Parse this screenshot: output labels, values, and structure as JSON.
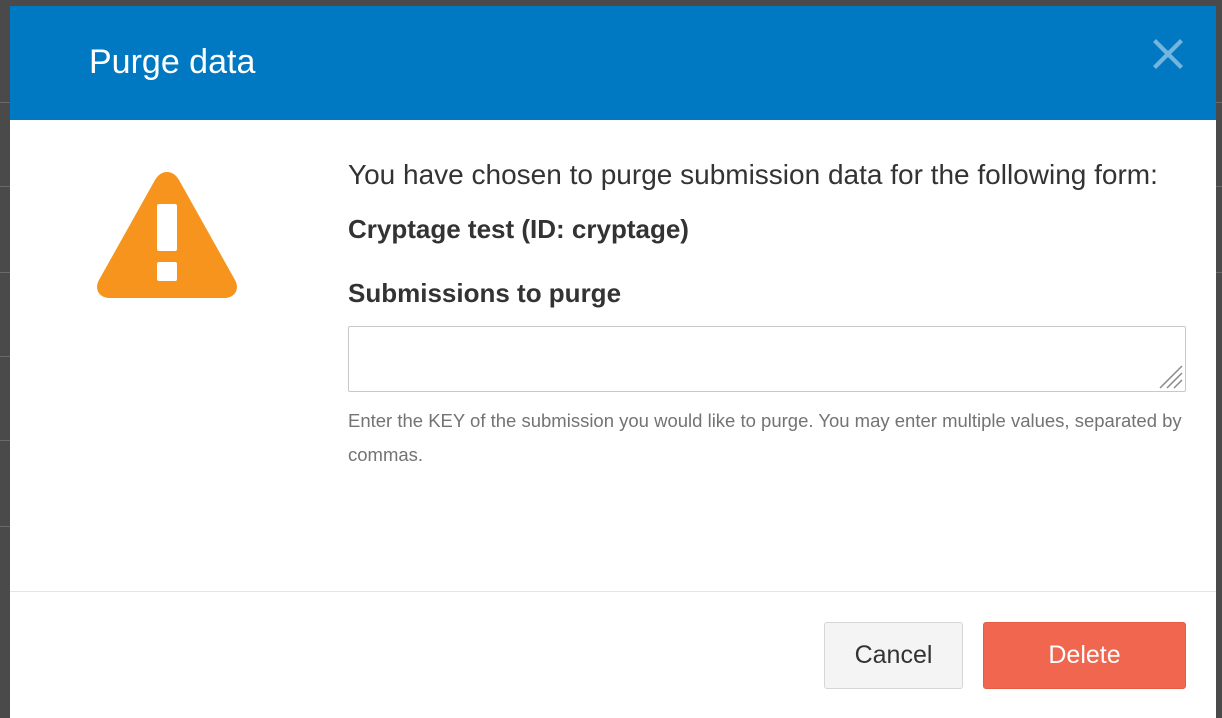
{
  "modal": {
    "title": "Purge data",
    "intro": "You have chosen to purge submission data for the following form:",
    "form_name": "Cryptage test (ID: cryptage)",
    "field_label": "Submissions to purge",
    "input_value": "",
    "help_text": "Enter the KEY of the submission you would like to purge. You may enter multiple values, separated by commas.",
    "cancel_label": "Cancel",
    "delete_label": "Delete"
  },
  "icons": {
    "close": "close-icon",
    "warning": "warning-icon"
  },
  "colors": {
    "header": "#0178c2",
    "warning": "#f7941d",
    "delete": "#f0664e",
    "cancel": "#f4f4f4"
  }
}
